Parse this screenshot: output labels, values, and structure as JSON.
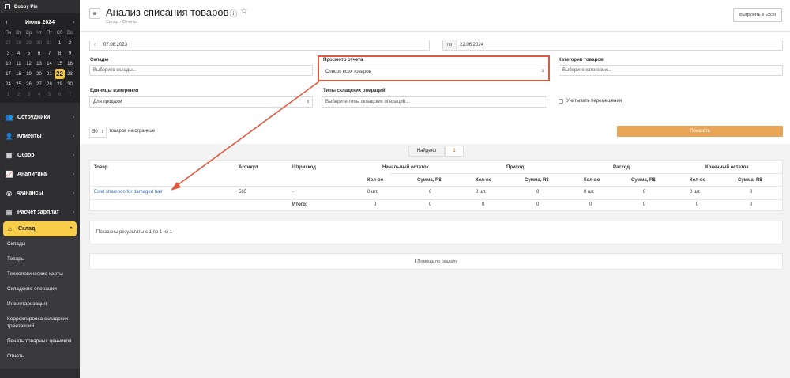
{
  "sidebar": {
    "brand": "Bobby Pin",
    "calendar": {
      "prev": "‹",
      "month": "Июнь 2024",
      "next": "›",
      "weekdays": [
        "Пн",
        "Вт",
        "Ср",
        "Чт",
        "Пт",
        "Сб",
        "Вс"
      ],
      "days": [
        {
          "d": "27",
          "c": "dim"
        },
        {
          "d": "28",
          "c": "dim"
        },
        {
          "d": "29",
          "c": "dim"
        },
        {
          "d": "30",
          "c": "dim"
        },
        {
          "d": "31",
          "c": "dim"
        },
        {
          "d": "1",
          "c": ""
        },
        {
          "d": "2",
          "c": ""
        },
        {
          "d": "3",
          "c": ""
        },
        {
          "d": "4",
          "c": ""
        },
        {
          "d": "5",
          "c": ""
        },
        {
          "d": "6",
          "c": ""
        },
        {
          "d": "7",
          "c": ""
        },
        {
          "d": "8",
          "c": ""
        },
        {
          "d": "9",
          "c": ""
        },
        {
          "d": "10",
          "c": ""
        },
        {
          "d": "11",
          "c": ""
        },
        {
          "d": "12",
          "c": ""
        },
        {
          "d": "13",
          "c": ""
        },
        {
          "d": "14",
          "c": ""
        },
        {
          "d": "15",
          "c": ""
        },
        {
          "d": "16",
          "c": ""
        },
        {
          "d": "17",
          "c": ""
        },
        {
          "d": "18",
          "c": ""
        },
        {
          "d": "19",
          "c": ""
        },
        {
          "d": "20",
          "c": ""
        },
        {
          "d": "21",
          "c": ""
        },
        {
          "d": "22",
          "c": "today"
        },
        {
          "d": "23",
          "c": ""
        },
        {
          "d": "24",
          "c": ""
        },
        {
          "d": "25",
          "c": ""
        },
        {
          "d": "26",
          "c": ""
        },
        {
          "d": "27",
          "c": ""
        },
        {
          "d": "28",
          "c": ""
        },
        {
          "d": "29",
          "c": ""
        },
        {
          "d": "30",
          "c": ""
        },
        {
          "d": "1",
          "c": "dim"
        },
        {
          "d": "2",
          "c": "dim"
        },
        {
          "d": "3",
          "c": "dim"
        },
        {
          "d": "4",
          "c": "dim"
        },
        {
          "d": "5",
          "c": "dim"
        },
        {
          "d": "6",
          "c": "dim"
        },
        {
          "d": "7",
          "c": "dim"
        }
      ]
    },
    "nav": [
      {
        "label": "Сотрудники",
        "icon": "users-icon",
        "glyph": "👥",
        "name": "nav-employees"
      },
      {
        "label": "Клиенты",
        "icon": "clients-icon",
        "glyph": "👤",
        "name": "nav-clients"
      },
      {
        "label": "Обзор",
        "icon": "overview-icon",
        "glyph": "▦",
        "name": "nav-overview"
      },
      {
        "label": "Аналитика",
        "icon": "analytics-icon",
        "glyph": "📈",
        "name": "nav-analytics"
      },
      {
        "label": "Финансы",
        "icon": "finance-icon",
        "glyph": "◎",
        "name": "nav-finance"
      },
      {
        "label": "Расчет зарплат",
        "icon": "salary-icon",
        "glyph": "▤",
        "name": "nav-salary"
      }
    ],
    "active": {
      "label": "Склад",
      "icon": "warehouse-icon"
    },
    "sub": [
      "Склады",
      "Товары",
      "Технологические карты",
      "Складские операции",
      "Инвентаризация",
      "Корректировка складских транзакций",
      "Печать товарных ценников",
      "Отчеты"
    ]
  },
  "header": {
    "title": "Анализ списания товаров",
    "breadcrumb": "Склад  ›  Отчеты",
    "excel": "Выгрузить в Excel"
  },
  "filters": {
    "date_from": "07.08.2023",
    "date_to_label": "по",
    "date_to": "22.06.2024",
    "warehouses_label": "Склады",
    "warehouses_ph": "Выберите склады...",
    "view_label": "Просмотр отчета",
    "view_value": "Список всех товаров",
    "categories_label": "Категории товаров",
    "categories_ph": "Выберите категории...",
    "units_label": "Единицы измерения",
    "units_value": "Для продажи",
    "ops_label": "Типы складских операций",
    "ops_ph": "Выберите типы складских операций...",
    "moves_label": "Учитывать перемещения",
    "per_page": "50",
    "per_page_label": "товаров на странице",
    "show": "Показать"
  },
  "found": {
    "label": "Найдено",
    "value": "1"
  },
  "table": {
    "h_product": "Товар",
    "h_sku": "Артикул",
    "h_barcode": "Штрихкод",
    "g_start": "Начальный остаток",
    "g_in": "Приход",
    "g_out": "Расход",
    "g_end": "Конечный остаток",
    "qty": "Кол-во",
    "sum": "Сумма, R$",
    "row": {
      "product": "Estel shampoo for damaged hair",
      "sku": "565",
      "barcode": "-",
      "s_qty": "0 шт.",
      "s_sum": "0",
      "i_qty": "0 шт.",
      "i_sum": "0",
      "o_qty": "0 шт.",
      "o_sum": "0",
      "e_qty": "0 шт.",
      "e_sum": "0"
    },
    "total": {
      "label": "Итого:",
      "s_qty": "0",
      "s_sum": "0",
      "i_qty": "0",
      "i_sum": "0",
      "o_qty": "0",
      "o_sum": "0",
      "e_qty": "0",
      "e_sum": "0"
    }
  },
  "results": "Показаны результаты с 1 по 1 из 1",
  "help": "ℹ Помощь по разделу",
  "accent": "#f7cd4a",
  "annotation_color": "#e05a3f"
}
